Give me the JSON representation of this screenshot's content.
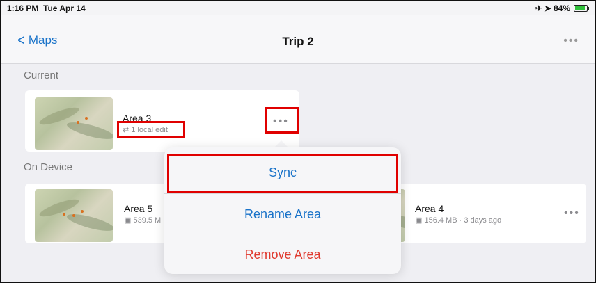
{
  "status_bar": {
    "time": "1:16 PM",
    "date": "Tue Apr 14",
    "battery": "84%"
  },
  "nav": {
    "back_label": "Maps",
    "title": "Trip 2",
    "more_icon": "ellipsis-icon"
  },
  "sections": {
    "current": "Current",
    "on_device": "On Device"
  },
  "current_areas": [
    {
      "name": "Area 3",
      "sub": "1 local edit"
    }
  ],
  "device_areas": [
    {
      "name": "Area 5",
      "sub": "539.5 M"
    },
    {
      "name": "Area 4",
      "sub": "156.4 MB · 3 days ago"
    }
  ],
  "menu": {
    "items": [
      "Sync",
      "Rename Area",
      "Remove Area"
    ]
  },
  "colors": {
    "accent": "#1a73c9",
    "destructive": "#e03a2f",
    "highlight": "#e00000"
  }
}
